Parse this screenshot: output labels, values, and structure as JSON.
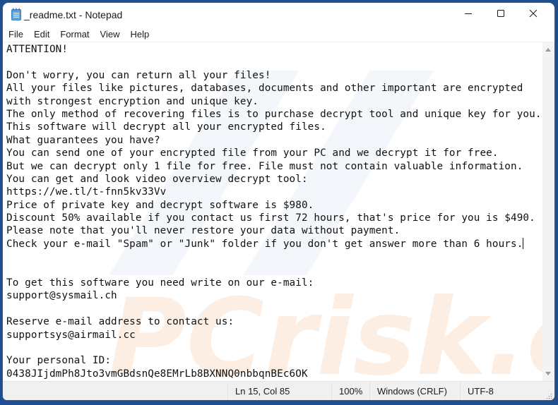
{
  "window": {
    "title": "_readme.txt - Notepad",
    "app_icon": "notepad-icon",
    "controls": {
      "minimize": "minimize-icon",
      "maximize": "maximize-icon",
      "close": "close-icon"
    }
  },
  "menubar": {
    "items": [
      {
        "label": "File"
      },
      {
        "label": "Edit"
      },
      {
        "label": "Format"
      },
      {
        "label": "View"
      },
      {
        "label": "Help"
      }
    ]
  },
  "editor": {
    "lines": [
      "ATTENTION!",
      "",
      "Don't worry, you can return all your files!",
      "All your files like pictures, databases, documents and other important are encrypted",
      "with strongest encryption and unique key.",
      "The only method of recovering files is to purchase decrypt tool and unique key for you.",
      "This software will decrypt all your encrypted files.",
      "What guarantees you have?",
      "You can send one of your encrypted file from your PC and we decrypt it for free.",
      "But we can decrypt only 1 file for free. File must not contain valuable information.",
      "You can get and look video overview decrypt tool:",
      "https://we.tl/t-fnn5kv33Vv",
      "Price of private key and decrypt software is $980.",
      "Discount 50% available if you contact us first 72 hours, that's price for you is $490.",
      "Please note that you'll never restore your data without payment.",
      "Check your e-mail \"Spam\" or \"Junk\" folder if you don't get answer more than 6 hours.",
      "",
      "",
      "To get this software you need write on our e-mail:",
      "support@sysmail.ch",
      "",
      "Reserve e-mail address to contact us:",
      "supportsys@airmail.cc",
      "",
      "Your personal ID:",
      "0438JIjdmPh8Jto3vmGBdsnQe8EMrLb8BXNNQ0nbbqnBEc6OK"
    ],
    "caret_line": 15,
    "watermark": "PCrisk.com"
  },
  "statusbar": {
    "position": "Ln 15, Col 85",
    "zoom": "100%",
    "line_ending": "Windows (CRLF)",
    "encoding": "UTF-8"
  }
}
